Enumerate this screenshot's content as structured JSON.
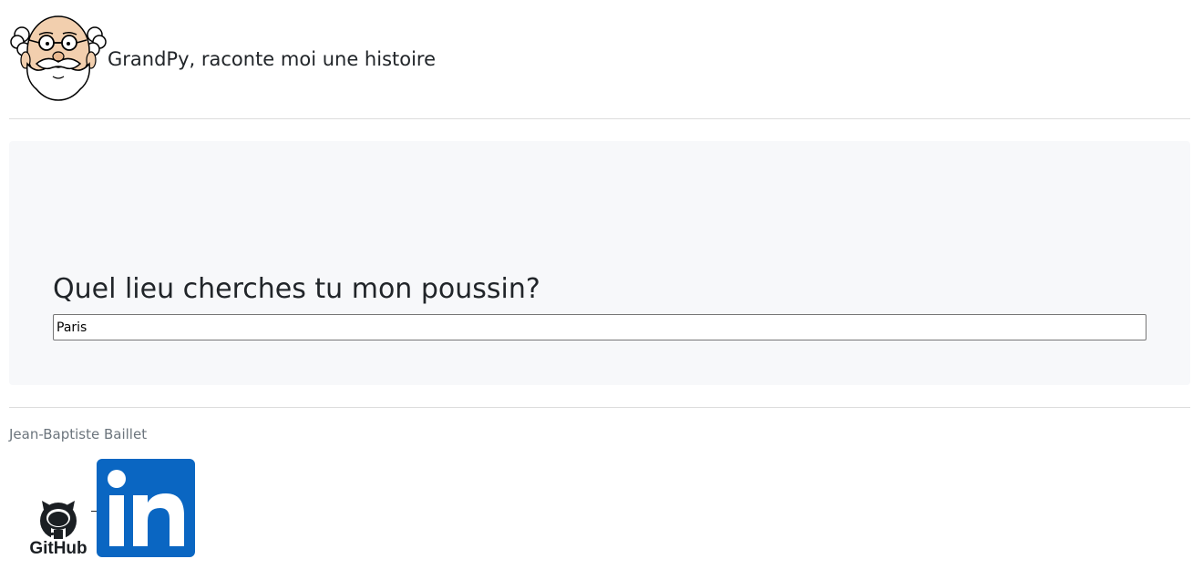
{
  "header": {
    "title": "GrandPy, raconte moi une histoire",
    "logo_icon": "grandpa-face-icon"
  },
  "main": {
    "question": "Quel lieu cherches tu mon poussin?",
    "search_value": "Paris"
  },
  "footer": {
    "author": "Jean-Baptiste Baillet",
    "links": [
      {
        "icon": "github-icon",
        "label": "GitHub"
      },
      {
        "icon": "linkedin-icon",
        "label": "in"
      }
    ]
  },
  "colors": {
    "jumbotron_bg": "#f7f8fa",
    "linkedin_blue": "#0a66c2",
    "muted_text": "#6c757d"
  }
}
